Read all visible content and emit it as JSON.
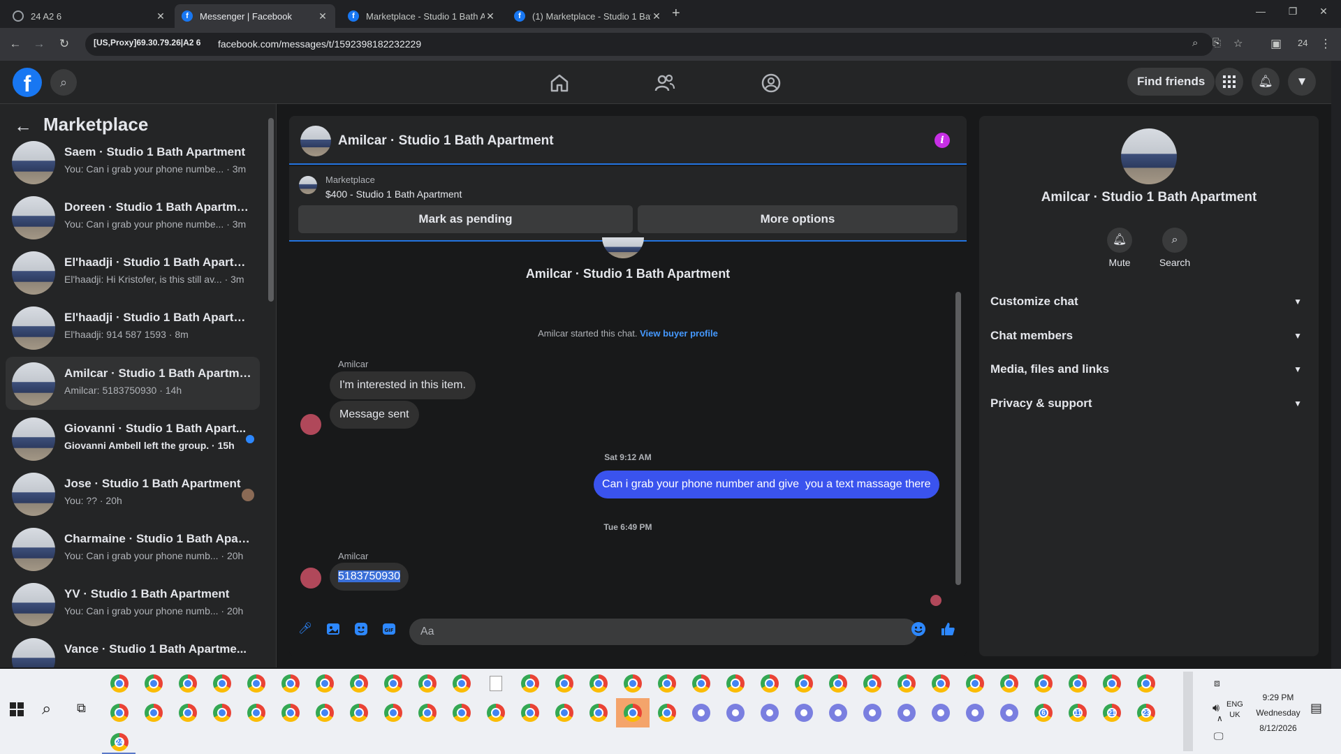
{
  "browser": {
    "tabs": [
      {
        "title": "24 A2 6",
        "icon": "globe-icon"
      },
      {
        "title": "Messenger | Facebook",
        "icon": "facebook-icon"
      },
      {
        "title": "Marketplace - Studio 1 Bath Ap",
        "icon": "facebook-icon"
      },
      {
        "title": "(1) Marketplace - Studio 1 Bath",
        "icon": "facebook-icon"
      }
    ],
    "proxy_chip": "[US,Proxy]69.30.79.26|A2 6",
    "url": "facebook.com/messages/t/1592398182232229",
    "profile_badge": "24"
  },
  "fb_nav": {
    "logo": "f",
    "find_friends": "Find friends"
  },
  "sidebar": {
    "title": "Marketplace",
    "conversations": [
      {
        "name": "Saem · Studio 1 Bath Apartment",
        "snippet": "You: Can i grab your phone numbe... · 3m",
        "unread": false
      },
      {
        "name": "Doreen · Studio 1 Bath Apartment",
        "snippet": "You: Can i grab your phone numbe... · 3m",
        "unread": false
      },
      {
        "name": "El'haadji · Studio 1 Bath Apartme...",
        "snippet": "El'haadji: Hi Kristofer, is this still av... · 3m",
        "unread": false
      },
      {
        "name": "El'haadji · Studio 1 Bath Apartme...",
        "snippet": "El'haadji: 914 587 1593 · 8m",
        "unread": false
      },
      {
        "name": "Amilcar · Studio 1 Bath Apartment",
        "snippet": "Amilcar: 5183750930 · 14h",
        "unread": false,
        "active": true
      },
      {
        "name": "Giovanni · Studio 1 Bath Apart...",
        "snippet": "Giovanni Ambell left the group. · 15h",
        "unread": true
      },
      {
        "name": "Jose · Studio 1 Bath Apartment",
        "snippet": "You: ?? · 20h",
        "unread": false
      },
      {
        "name": "Charmaine · Studio 1 Bath Apart...",
        "snippet": "You: Can i grab your phone numb... · 20h",
        "unread": false
      },
      {
        "name": "YV · Studio 1 Bath Apartment",
        "snippet": "You: Can i grab your phone numb... · 20h",
        "unread": false
      },
      {
        "name": "Vance · Studio 1 Bath Apartme...",
        "snippet": "",
        "unread": false
      }
    ]
  },
  "chat": {
    "title": "Amilcar · Studio 1 Bath Apartment",
    "listing_label": "Marketplace",
    "listing_price": "$400 - Studio 1 Bath Apartment",
    "mark_pending": "Mark as pending",
    "more_options": "More options",
    "thread_title": "Amilcar · Studio 1 Bath Apartment",
    "started_text": "Amilcar started this chat.",
    "view_buyer": "View buyer profile",
    "sender1": "Amilcar",
    "msg1": "I'm interested in this item.",
    "msg2": "Message sent",
    "time1": "Sat 9:12 AM",
    "msg_out": "Can i grab your phone number and give  you a text massage there",
    "time2": "Tue 6:49 PM",
    "sender2": "Amilcar",
    "msg3": "5183750930",
    "input_placeholder": "Aa"
  },
  "info_panel": {
    "name": "Amilcar · Studio 1 Bath Apartment",
    "mute": "Mute",
    "search": "Search",
    "rows": [
      "Customize chat",
      "Chat members",
      "Media, files and links",
      "Privacy & support"
    ]
  },
  "taskbar": {
    "lang1": "ENG",
    "lang2": "UK",
    "time": "9:29 PM",
    "day": "Wednesday",
    "date": "8/12/2026",
    "badges": [
      "6",
      "11",
      "21",
      "23",
      "24"
    ]
  },
  "colors": {
    "fb_blue": "#1877f2",
    "bubble_out": "#3a53ee",
    "info_purple": "#c72fe5",
    "unread_dot": "#2d88ff"
  }
}
